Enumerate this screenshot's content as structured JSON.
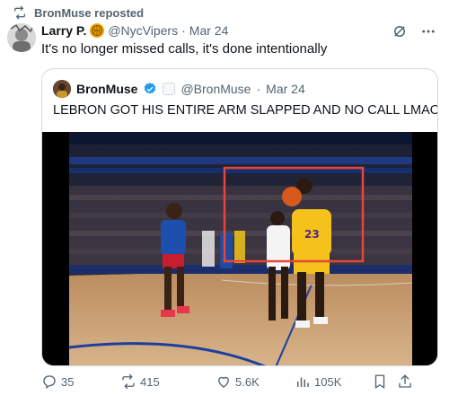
{
  "repost": {
    "label": "BronMuse reposted",
    "icon": "repost-icon"
  },
  "tweet": {
    "author_name": "Larry P.",
    "badge_icon": "basketball-icon",
    "handle": "@NycVipers",
    "separator": "·",
    "date": "Mar 24",
    "text": "It's no longer missed calls, it's done intentionally",
    "top_icons": [
      "grok-icon",
      "more-icon"
    ]
  },
  "quote": {
    "author_name": "BronMuse",
    "verified_icon": "verified-badge-icon",
    "handle": "@BronMuse",
    "separator": "·",
    "date": "Mar 24",
    "text": "LEBRON GOT HIS ENTIRE ARM SLAPPED AND NO CALL LMAOO???",
    "video_highlight_color": "#e8453c"
  },
  "actions": {
    "replies": "35",
    "reposts": "415",
    "likes": "5.6K",
    "views": "105K"
  },
  "colors": {
    "muted": "#536471",
    "border": "#cfd9de",
    "text": "#0f1419",
    "verified": "#1d9bf0"
  }
}
